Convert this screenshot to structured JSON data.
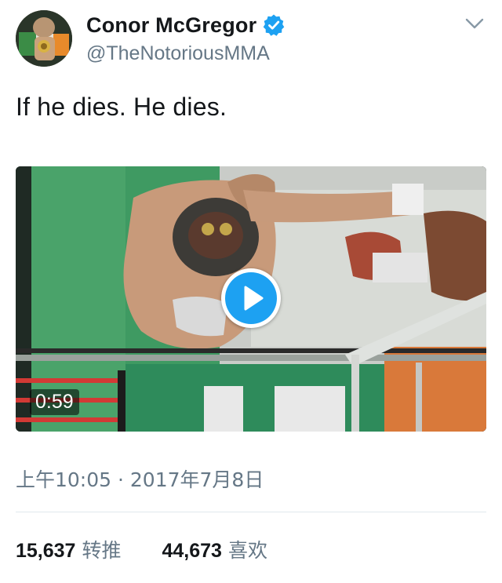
{
  "user": {
    "display_name": "Conor McGregor",
    "handle": "@TheNotoriousMMA",
    "verified": true,
    "verified_icon": "verified-badge-icon",
    "avatar_icon": "avatar"
  },
  "tweet": {
    "text": "If he dies. He dies.",
    "timestamp": "上午10:05 · 2017年7月8日"
  },
  "media": {
    "type": "video",
    "duration": "0:59",
    "play_icon": "play-icon"
  },
  "stats": {
    "retweets_count": "15,637",
    "retweets_label": "转推",
    "likes_count": "44,673",
    "likes_label": "喜欢"
  },
  "colors": {
    "accent": "#1da1f2",
    "text": "#14171a",
    "secondary_text": "#657786",
    "divider": "#e1e8ed"
  }
}
